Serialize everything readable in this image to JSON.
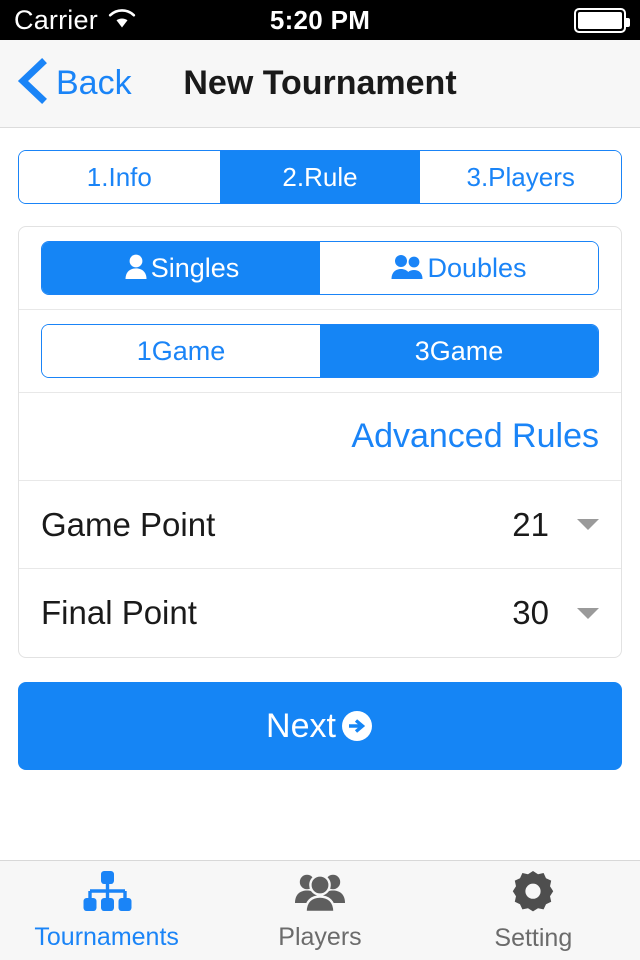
{
  "status_bar": {
    "carrier": "Carrier",
    "wifi_icon": "wifi-icon",
    "time": "5:20 PM",
    "battery_icon": "battery-icon"
  },
  "nav_bar": {
    "back_icon": "chevron-left-icon",
    "back_label": "Back",
    "title": "New Tournament"
  },
  "steps": [
    {
      "label": "1.Info",
      "active": false
    },
    {
      "label": "2.Rule",
      "active": true
    },
    {
      "label": "3.Players",
      "active": false
    }
  ],
  "rules": {
    "match_type": {
      "options": [
        {
          "label": "Singles",
          "icon": "single-person-icon",
          "active": true
        },
        {
          "label": "Doubles",
          "icon": "two-person-icon",
          "active": false
        }
      ]
    },
    "game_count": {
      "options": [
        {
          "label": "1Game",
          "active": false
        },
        {
          "label": "3Game",
          "active": true
        }
      ]
    },
    "advanced_link": "Advanced Rules",
    "fields": [
      {
        "label": "Game Point",
        "value": "21",
        "caret_icon": "caret-down-icon"
      },
      {
        "label": "Final Point",
        "value": "30",
        "caret_icon": "caret-down-icon"
      }
    ]
  },
  "next_button": {
    "label": "Next",
    "icon": "arrow-circle-right-icon"
  },
  "tab_bar": [
    {
      "label": "Tournaments",
      "icon": "sitemap-icon",
      "active": true
    },
    {
      "label": "Players",
      "icon": "group-people-icon",
      "active": false
    },
    {
      "label": "Setting",
      "icon": "gear-icon",
      "active": false
    }
  ],
  "colors": {
    "accent_blue": "#1585f5",
    "link_blue": "#1a84f7",
    "tab_inactive": "#6b6b6b",
    "caret_gray": "#9a9a9a"
  }
}
